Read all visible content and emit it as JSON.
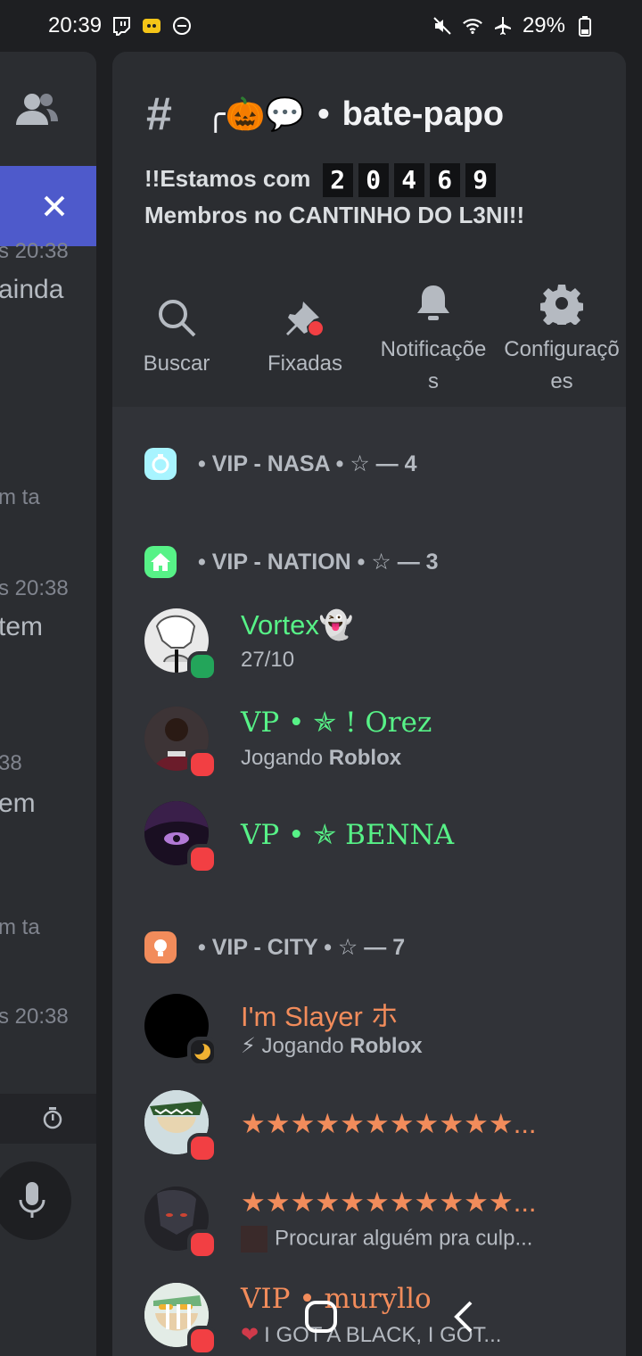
{
  "status_bar": {
    "time": "20:39",
    "battery": "29%"
  },
  "left_panel": {
    "timestamps": [
      "s 20:38",
      "s 20:38",
      "38",
      "s 20:38"
    ],
    "snippets": [
      "ainda",
      "m ta",
      "tem",
      "em",
      "m ta"
    ]
  },
  "channel": {
    "hash": "#",
    "emoji": "╭🎃💬",
    "dot": "•",
    "name": "bate-papo",
    "topic_prefix": "!!Estamos com",
    "member_digits": [
      "2",
      "0",
      "4",
      "6",
      "9"
    ],
    "topic_suffix": "Membros no CANTINHO DO L3NI!!"
  },
  "toolbar": {
    "search": "Buscar",
    "pinned": "Fixadas",
    "notifications": "Notificaçõe\ns",
    "settings": "Configuraçõ\nes"
  },
  "roles": [
    {
      "label": "• VIP - NASA • ☆ — 4",
      "color": "#a8f4ff"
    },
    {
      "label": "• VIP - NATION • ☆ — 3",
      "color": "#57f287"
    },
    {
      "label": "• VIP - CITY • ☆ — 7",
      "color": "#f28c5b"
    }
  ],
  "members": [
    {
      "name": "Vortex👻",
      "activity": "27/10",
      "status": "online"
    },
    {
      "name": "VP • ✯ ! Orez",
      "activity_prefix": "Jogando ",
      "activity_bold": "Roblox",
      "status": "dnd"
    },
    {
      "name": "VP • ✯ BENNA",
      "activity": "",
      "status": "dnd"
    },
    {
      "name": "I'm Slayer ホ",
      "activity_prefix": "⚡ Jogando ",
      "activity_bold": "Roblox",
      "status": "idle"
    },
    {
      "name": "★★★★★★★★★★★...",
      "activity": "",
      "status": "dnd"
    },
    {
      "name": "★★★★★★★★★★★...",
      "activity": "Procurar alguém pra culp...",
      "status": "dnd"
    },
    {
      "name": "VIP • muryllo",
      "activity": "I GOT A BLACK, I GOT...",
      "status": "dnd"
    }
  ],
  "colors": {
    "accent": "#5865f2",
    "online": "#23a55a",
    "dnd": "#f23f43",
    "idle": "#f0b232",
    "green_role": "#57f287",
    "orange_role": "#f28c5b"
  }
}
